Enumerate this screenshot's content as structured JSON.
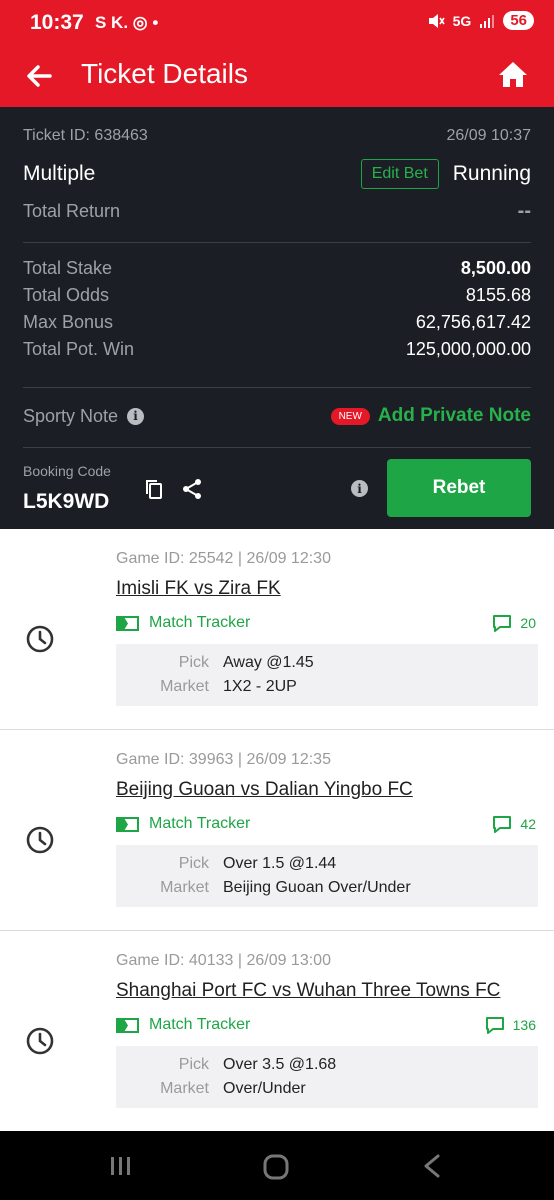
{
  "status_bar": {
    "time": "10:37",
    "left_icons": "S K. ◎ •",
    "network": "5G",
    "battery": "56"
  },
  "header": {
    "title": "Ticket Details"
  },
  "ticket": {
    "id_label": "Ticket ID: 638463",
    "datetime": "26/09 10:37",
    "type": "Multiple",
    "edit_label": "Edit Bet",
    "status": "Running",
    "total_return_label": "Total Return",
    "total_return_value": "--",
    "total_stake_label": "Total Stake",
    "total_stake_value": "8,500.00",
    "total_odds_label": "Total Odds",
    "total_odds_value": "8155.68",
    "max_bonus_label": "Max Bonus",
    "max_bonus_value": "62,756,617.42",
    "pot_win_label": "Total Pot. Win",
    "pot_win_value": "125,000,000.00",
    "note_label": "Sporty Note",
    "new_badge": "NEW",
    "add_note_label": "Add Private Note",
    "booking_label": "Booking Code",
    "booking_code": "L5K9WD",
    "rebet_label": "Rebet"
  },
  "pick_label_text": "Pick",
  "market_label_text": "Market",
  "games": [
    {
      "meta": "Game ID: 25542 | 26/09 12:30",
      "title": "Imisli FK vs Zira FK",
      "tracker": "Match Tracker",
      "comments": "20",
      "pick": "Away @1.45",
      "market": "1X2 - 2UP"
    },
    {
      "meta": "Game ID: 39963 | 26/09 12:35",
      "title": "Beijing Guoan vs Dalian Yingbo FC",
      "tracker": "Match Tracker",
      "comments": "42",
      "pick": "Over 1.5 @1.44",
      "market": "Beijing Guoan Over/Under"
    },
    {
      "meta": "Game ID: 40133 | 26/09 13:00",
      "title": "Shanghai Port FC vs Wuhan Three Towns FC",
      "tracker": "Match Tracker",
      "comments": "136",
      "pick": "Over 3.5 @1.68",
      "market": "Over/Under"
    }
  ],
  "icons": {
    "back": "arrow-left-icon",
    "home": "home-icon",
    "info": "info-icon",
    "copy": "copy-icon",
    "share": "share-icon",
    "clock": "clock-icon",
    "tracker": "match-tracker-icon",
    "comment": "comment-icon"
  },
  "colors": {
    "brand_red": "#e41827",
    "dark_bg": "#1b1e24",
    "accent_green": "#1ea546"
  }
}
